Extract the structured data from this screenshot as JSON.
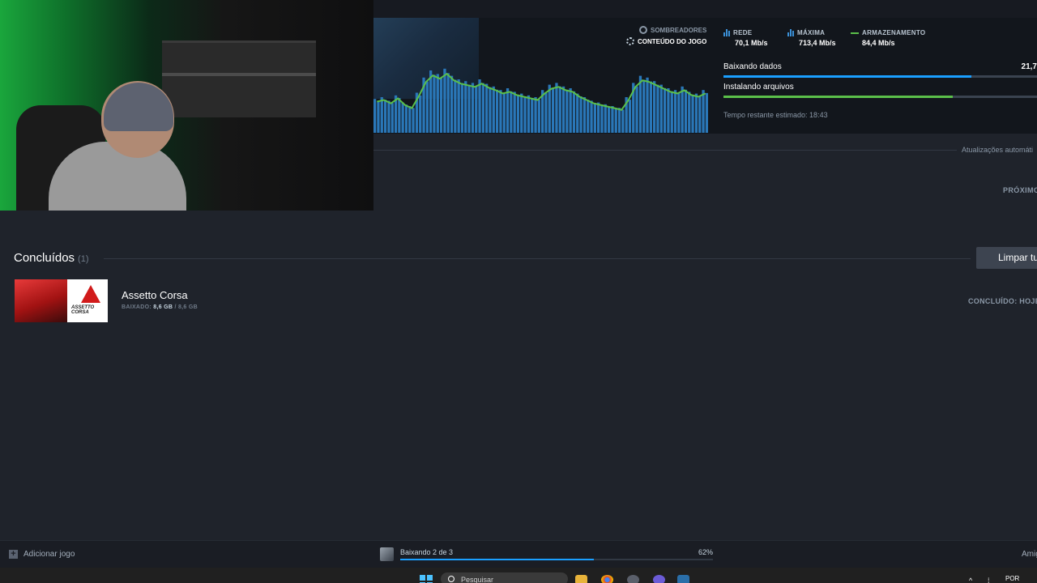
{
  "downloads": {
    "shaders_label": "SOMBREADORES",
    "game_content_label": "CONTEÚDO DO JOGO",
    "stats": {
      "network_label": "REDE",
      "network_value": "70,1 Mb/s",
      "peak_label": "MÁXIMA",
      "peak_value": "713,4 Mb/s",
      "storage_label": "ARMAZENAMENTO",
      "storage_value": "84,4 Mb/s"
    },
    "downloading_label": "Baixando dados",
    "downloading_right": "21,7",
    "downloading_progress": 0.79,
    "installing_label": "Instalando arquivos",
    "installing_progress": 0.73,
    "eta": "Tempo restante estimado: 18:43",
    "graph_series": [
      38,
      40,
      36,
      42,
      34,
      30,
      45,
      62,
      70,
      66,
      72,
      64,
      60,
      58,
      56,
      60,
      55,
      52,
      48,
      50,
      46,
      44,
      42,
      40,
      48,
      54,
      56,
      52,
      50,
      44,
      40,
      36,
      34,
      32,
      30,
      28,
      40,
      56,
      64,
      62,
      58,
      54,
      50,
      48,
      52,
      46,
      44,
      48
    ]
  },
  "queue": {
    "auto_updates": "Atualizações automáti",
    "next_label": "PRÓXIMO"
  },
  "completed": {
    "title": "Concluídos",
    "count": "(1)",
    "clear_button": "Limpar tu",
    "items": [
      {
        "name": "Assetto Corsa",
        "downloaded_prefix": "BAIXADO: ",
        "downloaded_value": "8,6 GB",
        "downloaded_total": " / 8,6 GB",
        "completed_when": "CONCLUÍDO: HOJE"
      }
    ]
  },
  "bottom_bar": {
    "add_game": "Adicionar jogo",
    "status": "Baixando 2 de 3",
    "percent": "62%",
    "progress": 0.62,
    "friends": "Amig"
  },
  "taskbar": {
    "search_placeholder": "Pesquisar",
    "language": "POR",
    "colors": {
      "accent": "#1a9fff",
      "green": "#5bc04a"
    }
  }
}
